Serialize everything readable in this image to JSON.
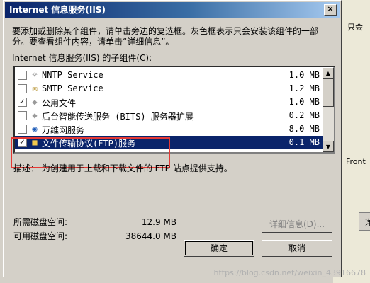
{
  "window": {
    "title": "Internet 信息服务(IIS)",
    "close_glyph": "×"
  },
  "instructions": "要添加或删除某个组件，请单击旁边的复选框。灰色框表示只会安装该组件的一部分。要查看组件内容，请单击“详细信息”。",
  "subcomponents_label": "Internet 信息服务(IIS) 的子组件(C):",
  "components": [
    {
      "name": "NNTP Service",
      "size": "1.0 MB",
      "checked": false,
      "icon": "news-icon"
    },
    {
      "name": "SMTP Service",
      "size": "1.2 MB",
      "checked": false,
      "icon": "mail-icon"
    },
    {
      "name": "公用文件",
      "size": "1.0 MB",
      "checked": true,
      "icon": "diamond-icon"
    },
    {
      "name": "后台智能传送服务 (BITS) 服务器扩展",
      "size": "0.2 MB",
      "checked": false,
      "icon": "diamond-icon"
    },
    {
      "name": "万维网服务",
      "size": "8.0 MB",
      "checked": false,
      "icon": "globe-icon"
    },
    {
      "name": "文件传输协议(FTP)服务",
      "size": "0.1 MB",
      "checked": true,
      "icon": "folder-icon",
      "selected": true
    }
  ],
  "description": "描述：  为创建用于上载和下载文件的 FTP 站点提供支持。",
  "disk": {
    "required_label": "所需磁盘空间:",
    "required_value": "12.9 MB",
    "available_label": "可用磁盘空间:",
    "available_value": "38644.0 MB"
  },
  "buttons": {
    "details": "详细信息(D)...",
    "ok": "确定",
    "cancel": "取消"
  },
  "background_window": {
    "fragment_1": "只会",
    "fragment_2": "Front",
    "fragment_3": "详"
  },
  "watermark": "https://blog.csdn.net/weixin_43916678",
  "colors": {
    "title_bar": "#0a246a",
    "selection": "#0a246a",
    "highlight_box": "#e53935",
    "dialog_face": "#d4d0c8"
  }
}
